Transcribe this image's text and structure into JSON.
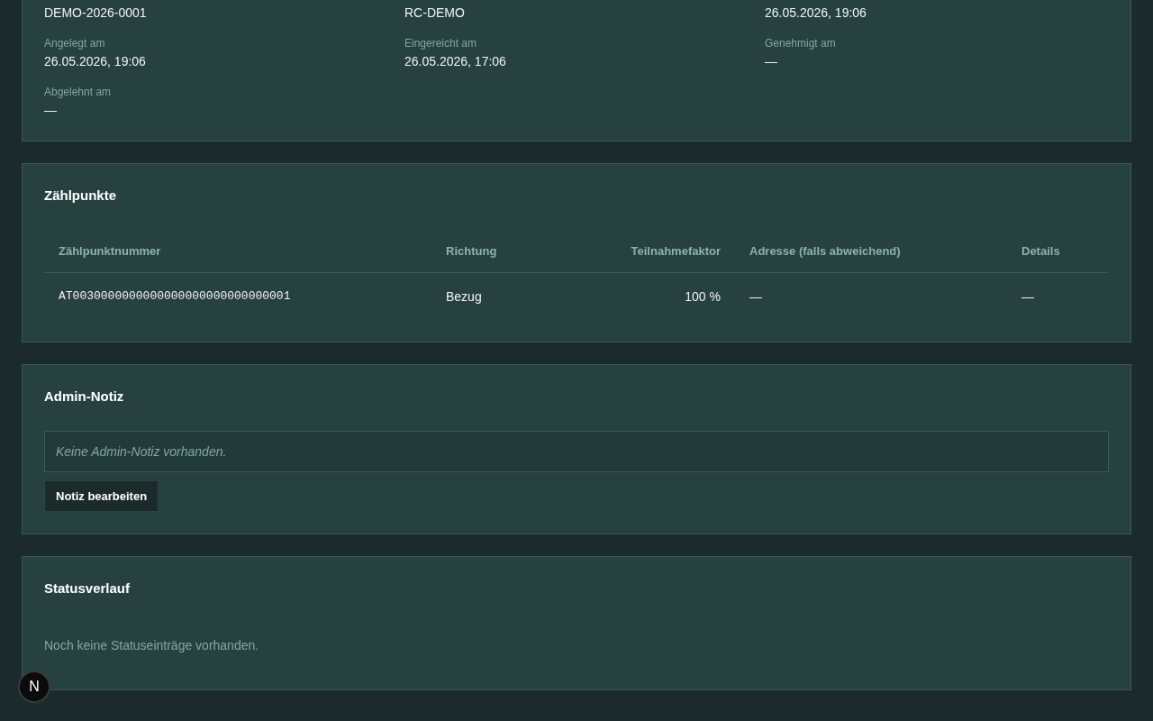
{
  "details_card": {
    "fields": [
      {
        "value": "DEMO-2026-0001"
      },
      {
        "value": "RC-DEMO"
      },
      {
        "value": "26.05.2026, 19:06"
      },
      {
        "label": "Angelegt am",
        "value": "26.05.2026, 19:06"
      },
      {
        "label": "Eingereicht am",
        "value": "26.05.2026, 17:06"
      },
      {
        "label": "Genehmigt am",
        "value": "—"
      },
      {
        "label": "Abgelehnt am",
        "value": "—"
      }
    ]
  },
  "metering_points": {
    "title": "Zählpunkte",
    "table": {
      "columns": [
        {
          "label": "Zählpunktnummer",
          "kind": "code"
        },
        {
          "label": "Richtung",
          "kind": "text"
        },
        {
          "label": "Teilnahmefaktor",
          "kind": "number"
        },
        {
          "label": "Adresse (falls abweichend)",
          "kind": "text"
        },
        {
          "label": "Details",
          "kind": "text"
        }
      ],
      "rows": [
        {
          "cells": [
            "AT0030000000000000000000000000001",
            "Bezug",
            "100 %",
            "—",
            "—"
          ]
        }
      ]
    }
  },
  "admin_note": {
    "title": "Admin-Notiz",
    "note": {
      "text": "Keine Admin-Notiz vorhanden.",
      "empty": true
    },
    "button": "Notiz bearbeiten"
  },
  "status_history": {
    "title": "Statusverlauf",
    "empty_text": "Noch keine Statuseinträge vorhanden."
  },
  "dev_badge": {
    "label": "N"
  }
}
